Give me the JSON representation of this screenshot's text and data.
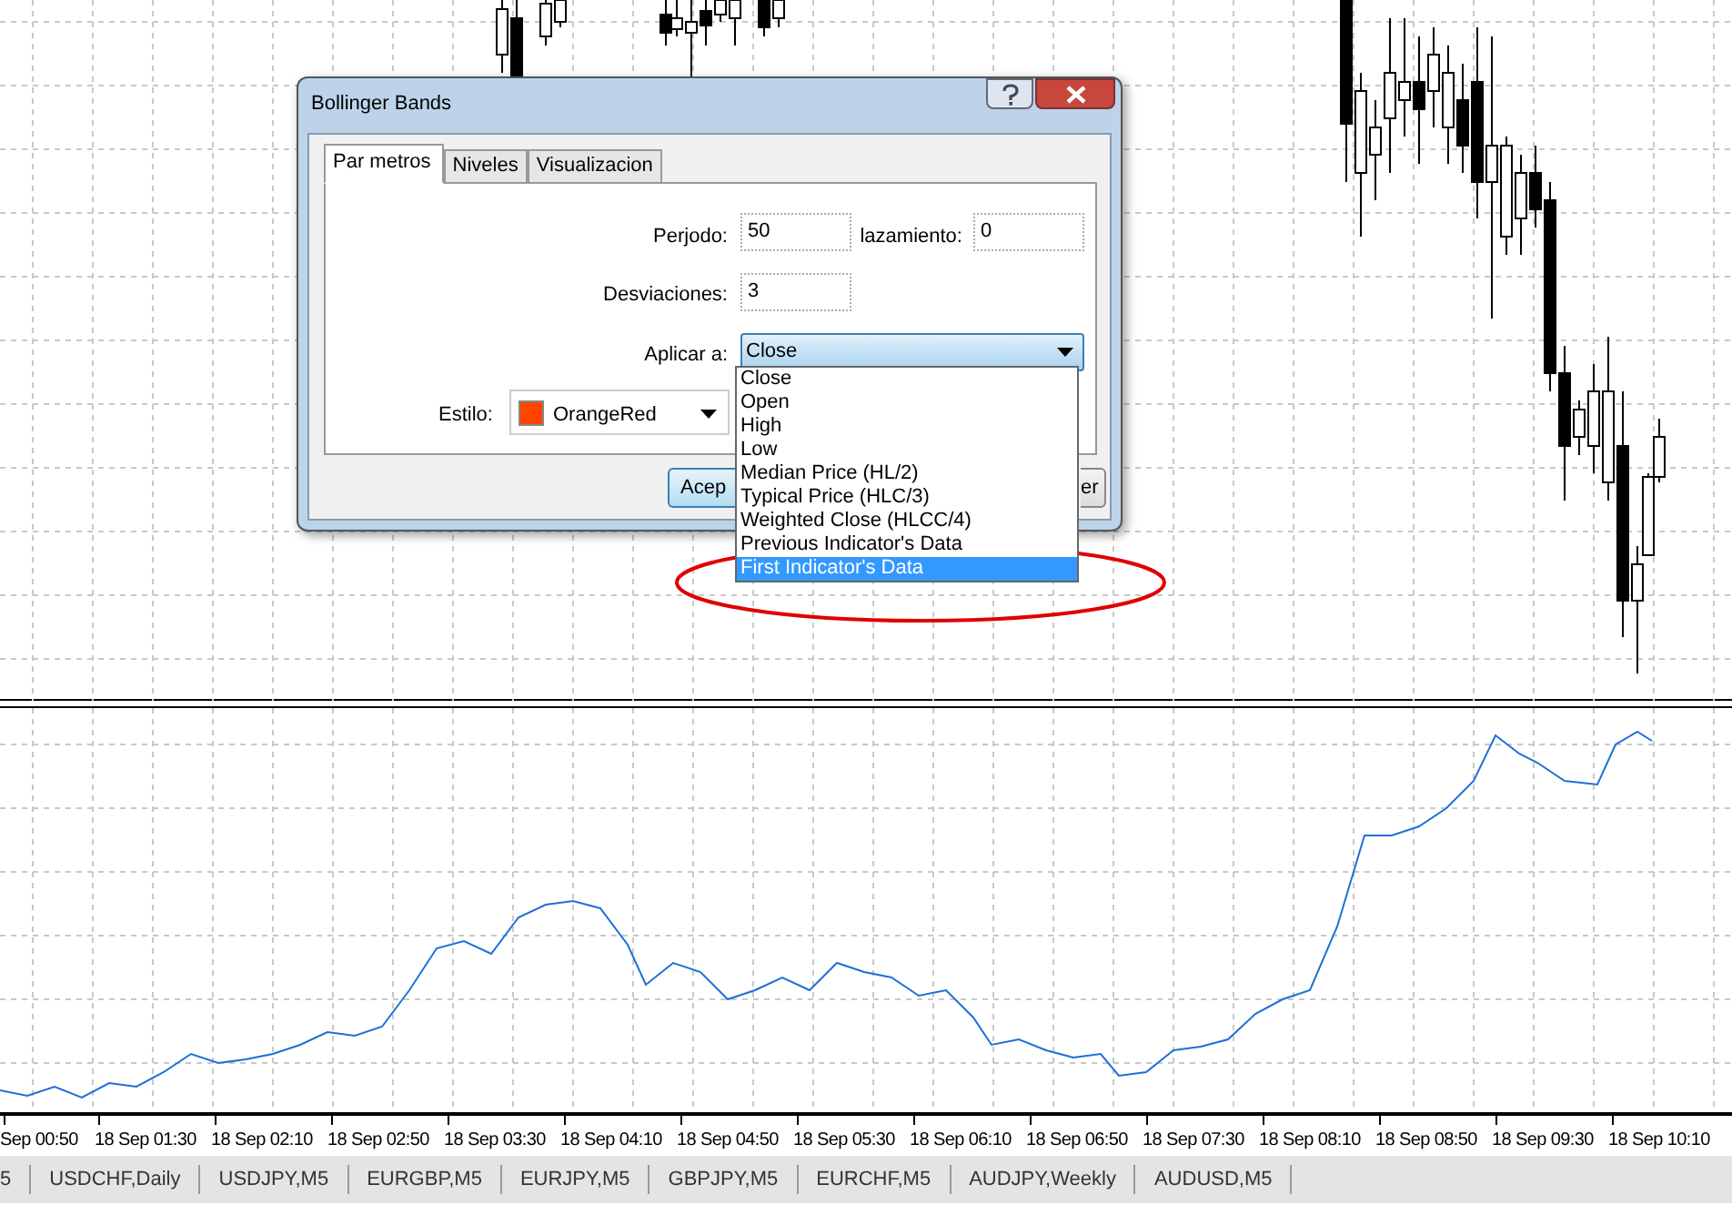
{
  "dialog": {
    "title": "Bollinger Bands",
    "tabs": [
      {
        "label": "Par metros",
        "selected": true
      },
      {
        "label": "Niveles",
        "selected": false
      },
      {
        "label": "Visualizacion",
        "selected": false
      }
    ],
    "fields": [
      {
        "label": "Perjodo:",
        "value": "50"
      },
      {
        "label": "lazamiento:",
        "value": "0"
      },
      {
        "label": "Desviaciones:",
        "value": "3"
      }
    ],
    "apply_to": {
      "label": "Aplicar a:",
      "value": "Close",
      "expanded": true,
      "options": [
        {
          "label": "Close",
          "highlighted": false
        },
        {
          "label": "Open",
          "highlighted": false
        },
        {
          "label": "High",
          "highlighted": false
        },
        {
          "label": "Low",
          "highlighted": false
        },
        {
          "label": "Median Price (HL/2)",
          "highlighted": false
        },
        {
          "label": "Typical Price (HLC/3)",
          "highlighted": false
        },
        {
          "label": "Weighted Close (HLCC/4)",
          "highlighted": false
        },
        {
          "label": "Previous Indicator's Data",
          "highlighted": false
        },
        {
          "label": "First Indicator's Data",
          "highlighted": true
        }
      ]
    },
    "style": {
      "label": "Estilo:",
      "value": "OrangeRed",
      "color": "#ff4500"
    },
    "buttons": [
      "Acep",
      "er"
    ]
  },
  "time_axis": [
    "Sep 00:50",
    "18 Sep 01:30",
    "18 Sep 02:10",
    "18 Sep 02:50",
    "18 Sep 03:30",
    "18 Sep 04:10",
    "18 Sep 04:50",
    "18 Sep 05:30",
    "18 Sep 06:10",
    "18 Sep 06:50",
    "18 Sep 07:30",
    "18 Sep 08:10",
    "18 Sep 08:50",
    "18 Sep 09:30",
    "18 Sep 10:10"
  ],
  "symbol_tabs": [
    "5",
    "USDCHF,Daily",
    "USDJPY,M5",
    "EURGBP,M5",
    "EURJPY,M5",
    "GBPJPY,M5",
    "EURCHF,M5",
    "AUDJPY,Weekly",
    "AUDUSD,M5"
  ]
}
